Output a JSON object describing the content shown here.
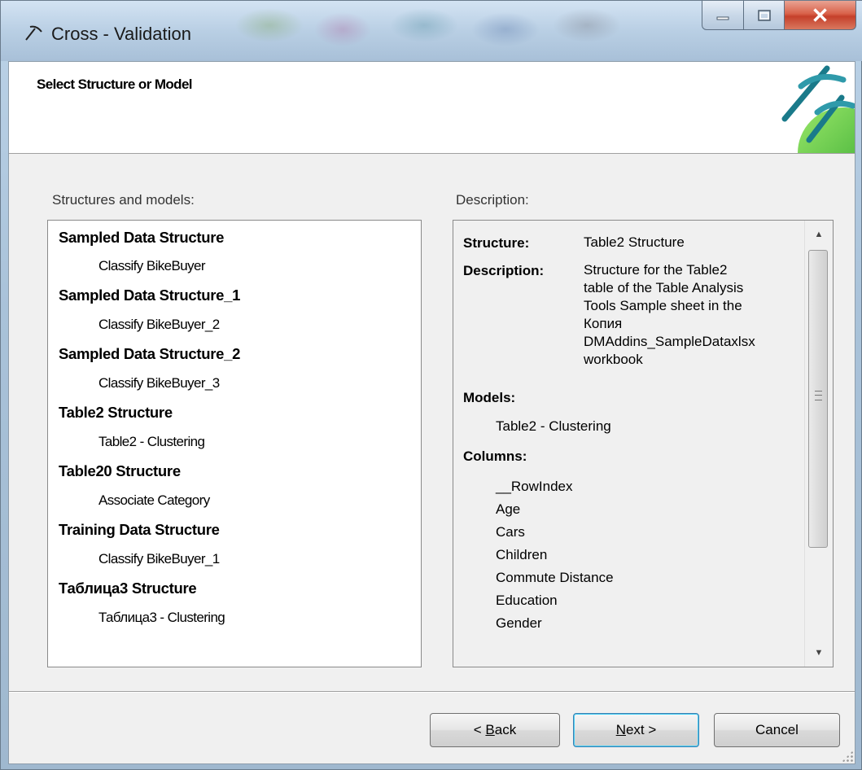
{
  "window": {
    "title": "Cross - Validation"
  },
  "header": {
    "title": "Select Structure or Model"
  },
  "left_panel": {
    "label": "Structures and models:",
    "items": [
      {
        "kind": "structure",
        "label": "Sampled Data Structure"
      },
      {
        "kind": "model",
        "label": "Classify BikeBuyer"
      },
      {
        "kind": "structure",
        "label": "Sampled Data Structure_1"
      },
      {
        "kind": "model",
        "label": "Classify BikeBuyer_2"
      },
      {
        "kind": "structure",
        "label": "Sampled Data Structure_2"
      },
      {
        "kind": "model",
        "label": "Classify BikeBuyer_3"
      },
      {
        "kind": "structure",
        "label": "Table2 Structure"
      },
      {
        "kind": "model",
        "label": "Table2 - Clustering"
      },
      {
        "kind": "structure",
        "label": "Table20 Structure"
      },
      {
        "kind": "model",
        "label": "Associate Category"
      },
      {
        "kind": "structure",
        "label": "Training Data Structure"
      },
      {
        "kind": "model",
        "label": "Classify BikeBuyer_1"
      },
      {
        "kind": "structure",
        "label": "Таблица3 Structure"
      },
      {
        "kind": "model",
        "label": "Таблица3 - Clustering"
      }
    ]
  },
  "right_panel": {
    "label": "Description:",
    "structure_label": "Structure:",
    "structure_value": "Table2 Structure",
    "description_label": "Description:",
    "description_lines": [
      "Structure for the Table2",
      "table of the Table Analysis",
      "Tools Sample sheet in the",
      "Копия",
      "DMAddins_SampleDataxlsx",
      "workbook"
    ],
    "models_label": "Models:",
    "models": [
      "Table2 - Clustering"
    ],
    "columns_label": "Columns:",
    "columns": [
      "__RowIndex",
      "Age",
      "Cars",
      "Children",
      "Commute Distance",
      "Education",
      "Gender"
    ]
  },
  "buttons": {
    "back_prefix": "< ",
    "back_mnemonic": "B",
    "back_rest": "ack",
    "next_mnemonic": "N",
    "next_rest": "ext >",
    "cancel": "Cancel"
  },
  "colors": {
    "title_bar": "#b9cfe4",
    "close_button": "#d9624a",
    "client_bg": "#f0f0f0",
    "header_bg": "#ffffff",
    "next_button_focus": "#48d0f5"
  }
}
